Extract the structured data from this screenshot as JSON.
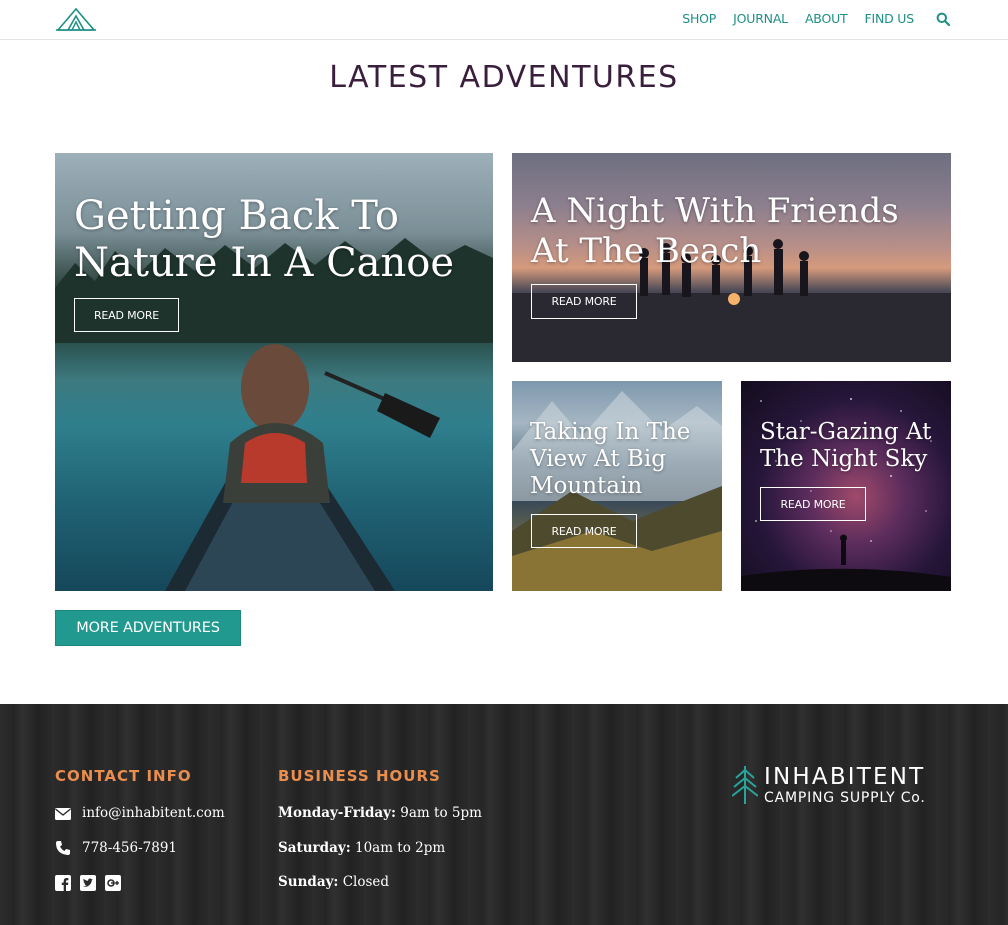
{
  "nav": {
    "items": [
      {
        "label": "SHOP"
      },
      {
        "label": "JOURNAL"
      },
      {
        "label": "ABOUT"
      },
      {
        "label": "FIND US"
      }
    ],
    "search_icon": "search-icon"
  },
  "section": {
    "title": "LATEST ADVENTURES",
    "more_label": "MORE ADVENTURES"
  },
  "cards": [
    {
      "title": "Getting Back To Nature In A Canoe",
      "button": "READ MORE"
    },
    {
      "title": "A Night With Friends At The Beach",
      "button": "READ MORE"
    },
    {
      "title": "Taking In The View At Big Mountain",
      "button": "READ MORE"
    },
    {
      "title": "Star-Gazing At The Night Sky",
      "button": "READ MORE"
    }
  ],
  "footer": {
    "contact": {
      "heading": "CONTACT INFO",
      "email": "info@inhabitent.com",
      "phone": "778-456-7891",
      "social_icons": [
        "facebook-icon",
        "twitter-icon",
        "google-plus-icon"
      ]
    },
    "hours": {
      "heading": "BUSINESS HOURS",
      "rows": [
        {
          "day": "Monday-Friday:",
          "time": "9am to 5pm"
        },
        {
          "day": "Saturday:",
          "time": "10am to 2pm"
        },
        {
          "day": "Sunday:",
          "time": "Closed"
        }
      ]
    },
    "brand": {
      "name": "INHABITENT",
      "tagline": "CAMPING SUPPLY Co."
    }
  },
  "colors": {
    "accent": "#21998f",
    "title": "#3a1f3d",
    "footer_heading": "#e98e4f"
  }
}
